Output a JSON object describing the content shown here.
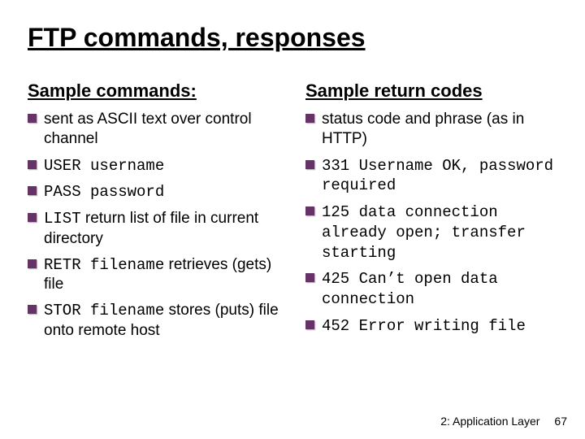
{
  "title": "FTP commands, responses",
  "left": {
    "heading": "Sample commands:",
    "items": [
      {
        "plain_pre": "sent as ASCII text over control channel",
        "mono": "",
        "plain_post": ""
      },
      {
        "plain_pre": "",
        "mono": "USER username",
        "plain_post": ""
      },
      {
        "plain_pre": "",
        "mono": "PASS password",
        "plain_post": ""
      },
      {
        "plain_pre": "",
        "mono": "LIST",
        "plain_post": " return list of file in current directory"
      },
      {
        "plain_pre": "",
        "mono": "RETR filename",
        "plain_post": " retrieves (gets) file"
      },
      {
        "plain_pre": "",
        "mono": "STOR filename",
        "plain_post": " stores (puts) file onto remote host"
      }
    ]
  },
  "right": {
    "heading": "Sample return codes",
    "items": [
      {
        "plain_pre": "status code and phrase (as in HTTP)",
        "mono": "",
        "plain_post": ""
      },
      {
        "plain_pre": "",
        "mono": "331 Username OK, password required",
        "plain_post": ""
      },
      {
        "plain_pre": "",
        "mono": "125 data connection already open; transfer starting",
        "plain_post": ""
      },
      {
        "plain_pre": "",
        "mono": "425 Can’t open data connection",
        "plain_post": ""
      },
      {
        "plain_pre": "",
        "mono": "452 Error writing file",
        "plain_post": ""
      }
    ]
  },
  "footer": {
    "section": "2: Application Layer",
    "page": "67"
  }
}
